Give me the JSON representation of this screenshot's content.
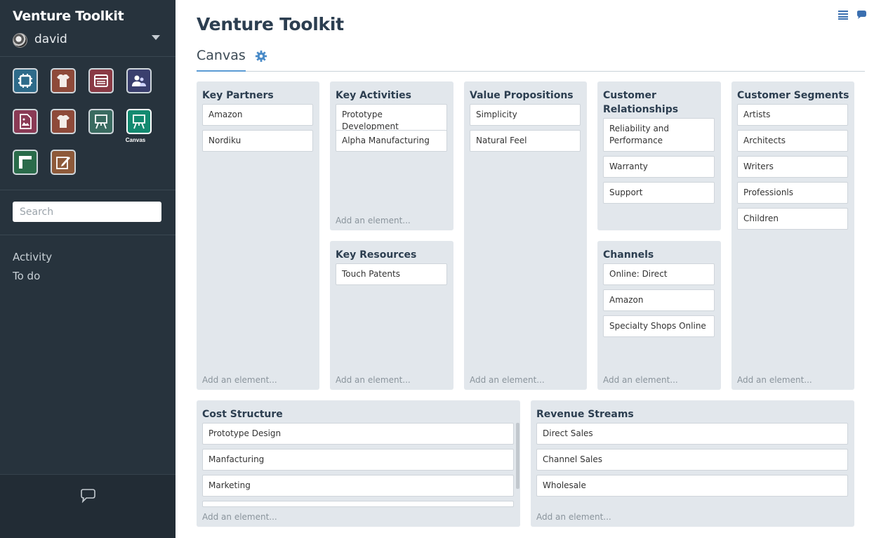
{
  "app": {
    "title": "Venture Toolkit",
    "user": "david",
    "icons": [
      {
        "name": "settings-app-icon",
        "color": "#2e6b8a"
      },
      {
        "name": "fit-app-icon",
        "color": "#8e4a3a"
      },
      {
        "name": "layout-app-icon",
        "color": "#8a3a45"
      },
      {
        "name": "people-app-icon",
        "color": "#3a3f6e"
      },
      {
        "name": "image-doc-app-icon",
        "color": "#8a3a55"
      },
      {
        "name": "fit-app-icon-2",
        "color": "#8e4a3a"
      },
      {
        "name": "easel-app-icon",
        "color": "#3a6b60"
      },
      {
        "name": "canvas-app-icon",
        "color": "#138a70"
      },
      {
        "name": "corner-app-icon",
        "color": "#2a6b4a"
      },
      {
        "name": "edit-app-icon",
        "color": "#8e5a3a"
      }
    ],
    "active_caption": "Canvas",
    "search_placeholder": "Search",
    "nav": [
      "Activity",
      "To do"
    ]
  },
  "page": {
    "title": "Venture Toolkit",
    "tab": "Canvas"
  },
  "canvas": {
    "add_label": "Add an element...",
    "key_partners": {
      "title": "Key Partners",
      "items": [
        "Amazon",
        "Nordiku"
      ]
    },
    "key_activities": {
      "title": "Key Activities",
      "items": [
        "Prototype Development",
        "Alpha Manufacturing"
      ]
    },
    "key_resources": {
      "title": "Key Resources",
      "items": [
        "Touch Patents"
      ]
    },
    "value_propositions": {
      "title": "Value Propositions",
      "items": [
        "Simplicity",
        "Natural Feel"
      ]
    },
    "customer_relationships": {
      "title_1": "Customer",
      "title_2": "Relationships",
      "items": [
        "Reliability and",
        "Performance",
        "Warranty",
        "Support"
      ]
    },
    "channels": {
      "title": "Channels",
      "items": [
        "Online: Direct",
        "Amazon",
        "Specialty Shops Online"
      ]
    },
    "customer_segments": {
      "title": "Customer Segments",
      "items": [
        "Artists",
        "Architects",
        "Writers",
        "Professionls",
        "Children"
      ]
    },
    "cost_structure": {
      "title": "Cost Structure",
      "items": [
        "Prototype Design",
        "Manfacturing",
        "Marketing"
      ]
    },
    "revenue_streams": {
      "title": "Revenue Streams",
      "items": [
        "Direct Sales",
        "Channel Sales",
        "Wholesale"
      ]
    }
  }
}
